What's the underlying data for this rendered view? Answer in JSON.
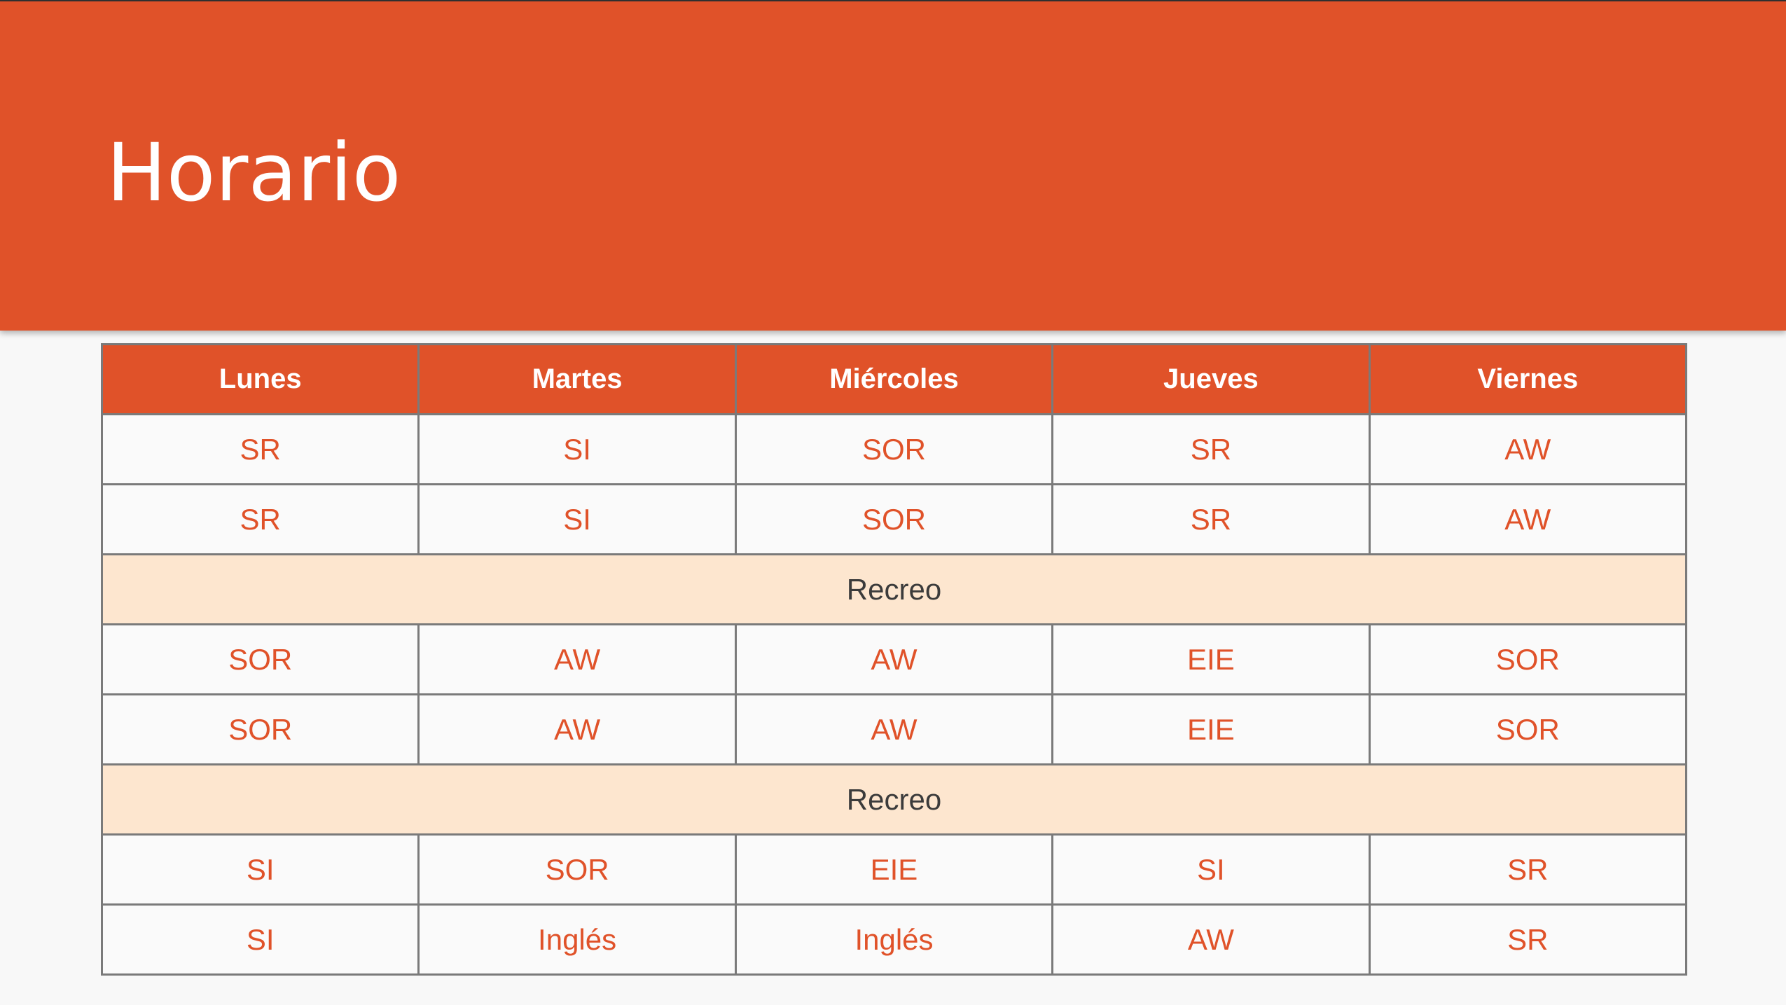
{
  "title": "Horario",
  "colors": {
    "accent": "#e05229",
    "break_background": "#fde6cf",
    "background": "#f8f8f8",
    "border": "#7a7a7a"
  },
  "days": [
    "Lunes",
    "Martes",
    "Miércoles",
    "Jueves",
    "Viernes"
  ],
  "rows": [
    [
      "SR",
      "SI",
      "SOR",
      "SR",
      "AW"
    ],
    [
      "SR",
      "SI",
      "SOR",
      "SR",
      "AW"
    ],
    [
      "Recreo"
    ],
    [
      "SOR",
      "AW",
      "AW",
      "EIE",
      "SOR"
    ],
    [
      "SOR",
      "AW",
      "AW",
      "EIE",
      "SOR"
    ],
    [
      "Recreo"
    ],
    [
      "SI",
      "SOR",
      "EIE",
      "SI",
      "SR"
    ],
    [
      "SI",
      "Inglés",
      "Inglés",
      "AW",
      "SR"
    ]
  ]
}
